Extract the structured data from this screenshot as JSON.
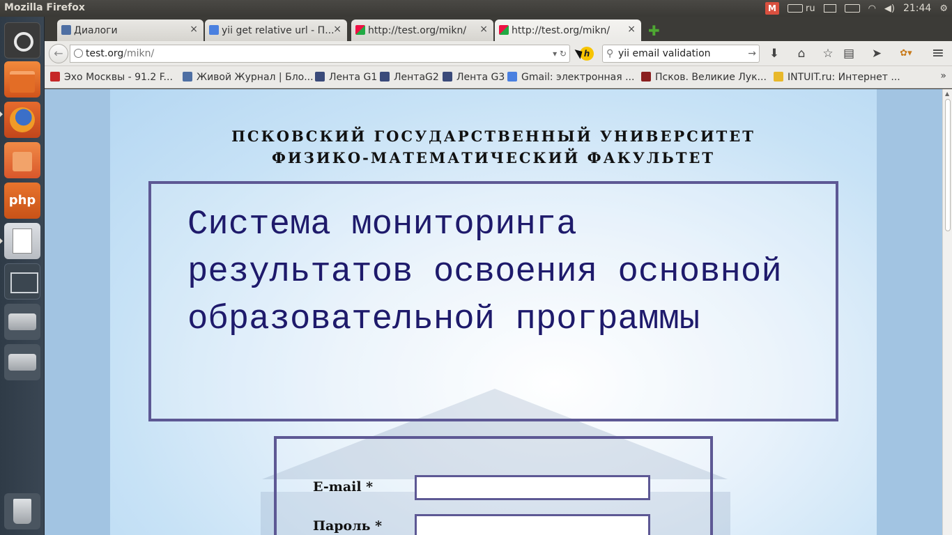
{
  "panel": {
    "app_title": "Mozilla Firefox",
    "mail_indicator": "M",
    "keyboard_layout": "ru",
    "clock": "21:44"
  },
  "launcher": {
    "php_label": "php"
  },
  "tabs": [
    {
      "label": "Диалоги",
      "close": "×"
    },
    {
      "label": "yii get relative url - П...",
      "close": "×"
    },
    {
      "label": "http://test.org/mikn/",
      "close": "×"
    },
    {
      "label": "http://test.org/mikn/",
      "close": "×"
    }
  ],
  "new_tab": "✚",
  "navbar": {
    "back": "←",
    "url_host": "test.org",
    "url_path": "/mikn/",
    "url_controls": "▾ ↻",
    "h_badge": "h",
    "search_placeholder": "yii email validation",
    "search_glass": "⚲",
    "search_go": "→",
    "download": "⬇",
    "home": "⌂",
    "star": "☆",
    "reading": "▤",
    "send": "➤",
    "extension": "✿▾",
    "menu": "≡"
  },
  "bookmarks": [
    {
      "label": "Эхо Москвы - 91.2 F...",
      "color": "#c62828"
    },
    {
      "label": "Живой Журнал | Бло...",
      "color": "#4e6fa3"
    },
    {
      "label": "Лента G1",
      "color": "#3a4a7a"
    },
    {
      "label": "ЛентаG2",
      "color": "#3a4a7a"
    },
    {
      "label": "Лента G3",
      "color": "#3a4a7a"
    },
    {
      "label": "Gmail: электронная ...",
      "color": "#4a80e0"
    },
    {
      "label": "Псков. Великие Лук...",
      "color": "#8a1f1f"
    },
    {
      "label": "INTUIT.ru: Интернет ...",
      "color": "#e8b82a"
    }
  ],
  "bookmarks_more": "»",
  "page": {
    "university": "ПСКОВСКИЙ ГОСУДАРСТВЕННЫЙ УНИВЕРСИТЕТ",
    "faculty": "ФИЗИКО-МАТЕМАТИЧЕСКИЙ ФАКУЛЬТЕТ",
    "system_title": "Система мониторинга результатов освоения основной образовательной программы",
    "email_label": "E-mail *",
    "email_value": "",
    "password_label": "Пароль *",
    "password_value": ""
  },
  "colors": {
    "accent_border": "#5d5894",
    "title_text": "#1e1a6b",
    "page_background": "#a2c4e2"
  }
}
